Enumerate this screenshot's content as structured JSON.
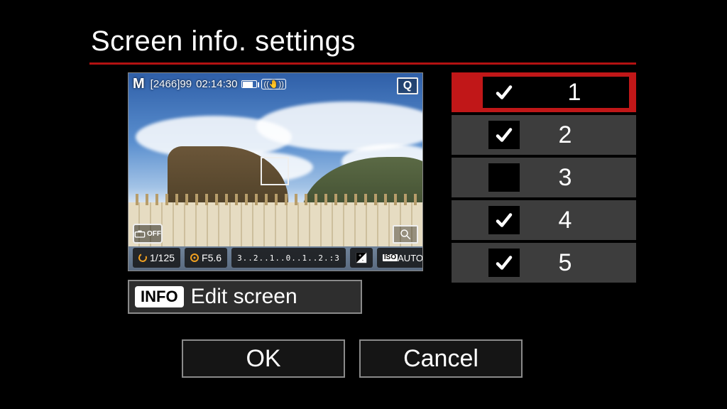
{
  "title": "Screen info. settings",
  "preview": {
    "mode": "M",
    "shots_remaining": "[2466]",
    "burst": "99",
    "rec_time": "02:14:30",
    "battery_icon": "battery-icon",
    "stabilizer_icon": "stabilizer-icon",
    "q_label": "Q",
    "off_label": "OFF",
    "shutter": "1/125",
    "aperture": "F5.6",
    "ev_scale": "3..2..1..0..1..2.:3",
    "expcomp_icon": "exposure-comp-icon",
    "iso_badge": "ISO",
    "iso_value": "AUTO",
    "magnify_icon": "magnify-icon"
  },
  "info_button": {
    "badge": "INFO",
    "label": "Edit screen"
  },
  "options": [
    {
      "n": "1",
      "checked": true,
      "selected": true
    },
    {
      "n": "2",
      "checked": true,
      "selected": false
    },
    {
      "n": "3",
      "checked": false,
      "selected": false
    },
    {
      "n": "4",
      "checked": true,
      "selected": false
    },
    {
      "n": "5",
      "checked": true,
      "selected": false
    }
  ],
  "buttons": {
    "ok": "OK",
    "cancel": "Cancel"
  },
  "colors": {
    "accent": "#c11718",
    "rule": "#b31111",
    "panel": "#3d3d3d"
  }
}
